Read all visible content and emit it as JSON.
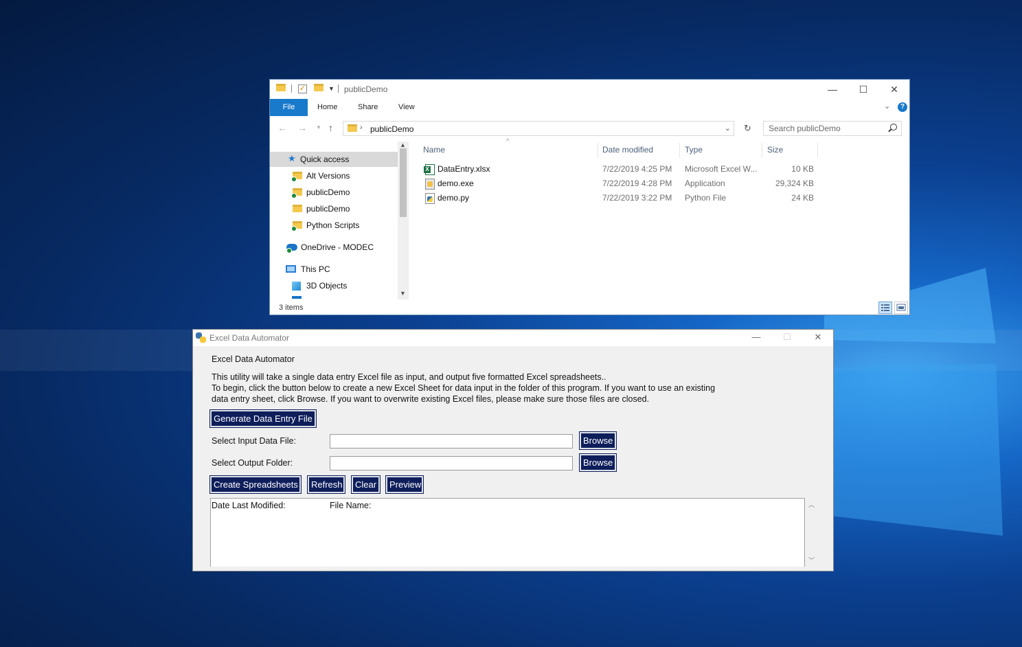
{
  "explorer": {
    "title": "publicDemo",
    "ribbon_tabs": [
      "File",
      "Home",
      "Share",
      "View"
    ],
    "address": {
      "path": "publicDemo"
    },
    "search_placeholder": "Search publicDemo",
    "nav_items": [
      {
        "label": "Quick access",
        "icon": "star-icon"
      },
      {
        "label": "Alt Versions",
        "icon": "folder-icon"
      },
      {
        "label": "publicDemo",
        "icon": "folder-icon"
      },
      {
        "label": "publicDemo",
        "icon": "folder-icon"
      },
      {
        "label": "Python Scripts",
        "icon": "folder-icon"
      },
      {
        "label": "OneDrive - MODEC",
        "icon": "cloud-icon"
      },
      {
        "label": "This PC",
        "icon": "computer-icon"
      },
      {
        "label": "3D Objects",
        "icon": "cube-icon"
      }
    ],
    "columns": [
      "Name",
      "Date modified",
      "Type",
      "Size"
    ],
    "files": [
      {
        "name": "DataEntry.xlsx",
        "modified": "7/22/2019 4:25 PM",
        "type": "Microsoft Excel W...",
        "size": "10 KB",
        "icon": "excel-icon"
      },
      {
        "name": "demo.exe",
        "modified": "7/22/2019 4:28 PM",
        "type": "Application",
        "size": "29,324 KB",
        "icon": "application-icon"
      },
      {
        "name": "demo.py",
        "modified": "7/22/2019 3:22 PM",
        "type": "Python File",
        "size": "24 KB",
        "icon": "python-file-icon"
      }
    ],
    "status": "3 items",
    "window_controls": {
      "minimize": "—",
      "maximize": "☐",
      "close": "✕"
    }
  },
  "app": {
    "title": "Excel Data Automator",
    "heading": "Excel Data Automator",
    "description": [
      "This utility will take a single data entry Excel file as input, and output five formatted Excel spreadsheets..",
      "To begin, click the button below to create a new Excel Sheet for data input in the folder of this program. If you want to use an existing",
      "data entry sheet, click Browse. If you want to overwrite existing Excel files, please make sure those files are closed."
    ],
    "generate_label": "Generate Data Entry File",
    "input_file_label": "Select Input Data File:",
    "input_file_value": "",
    "output_folder_label": "Select Output Folder:",
    "output_folder_value": "",
    "browse_label": "Browse",
    "actions": [
      "Create Spreadsheets",
      "Refresh",
      "Clear",
      "Preview"
    ],
    "log_headers": {
      "date": "Date Last Modified:",
      "file": "File Name:"
    },
    "window_controls": {
      "minimize": "—",
      "maximize": "☐",
      "close": "✕"
    }
  }
}
